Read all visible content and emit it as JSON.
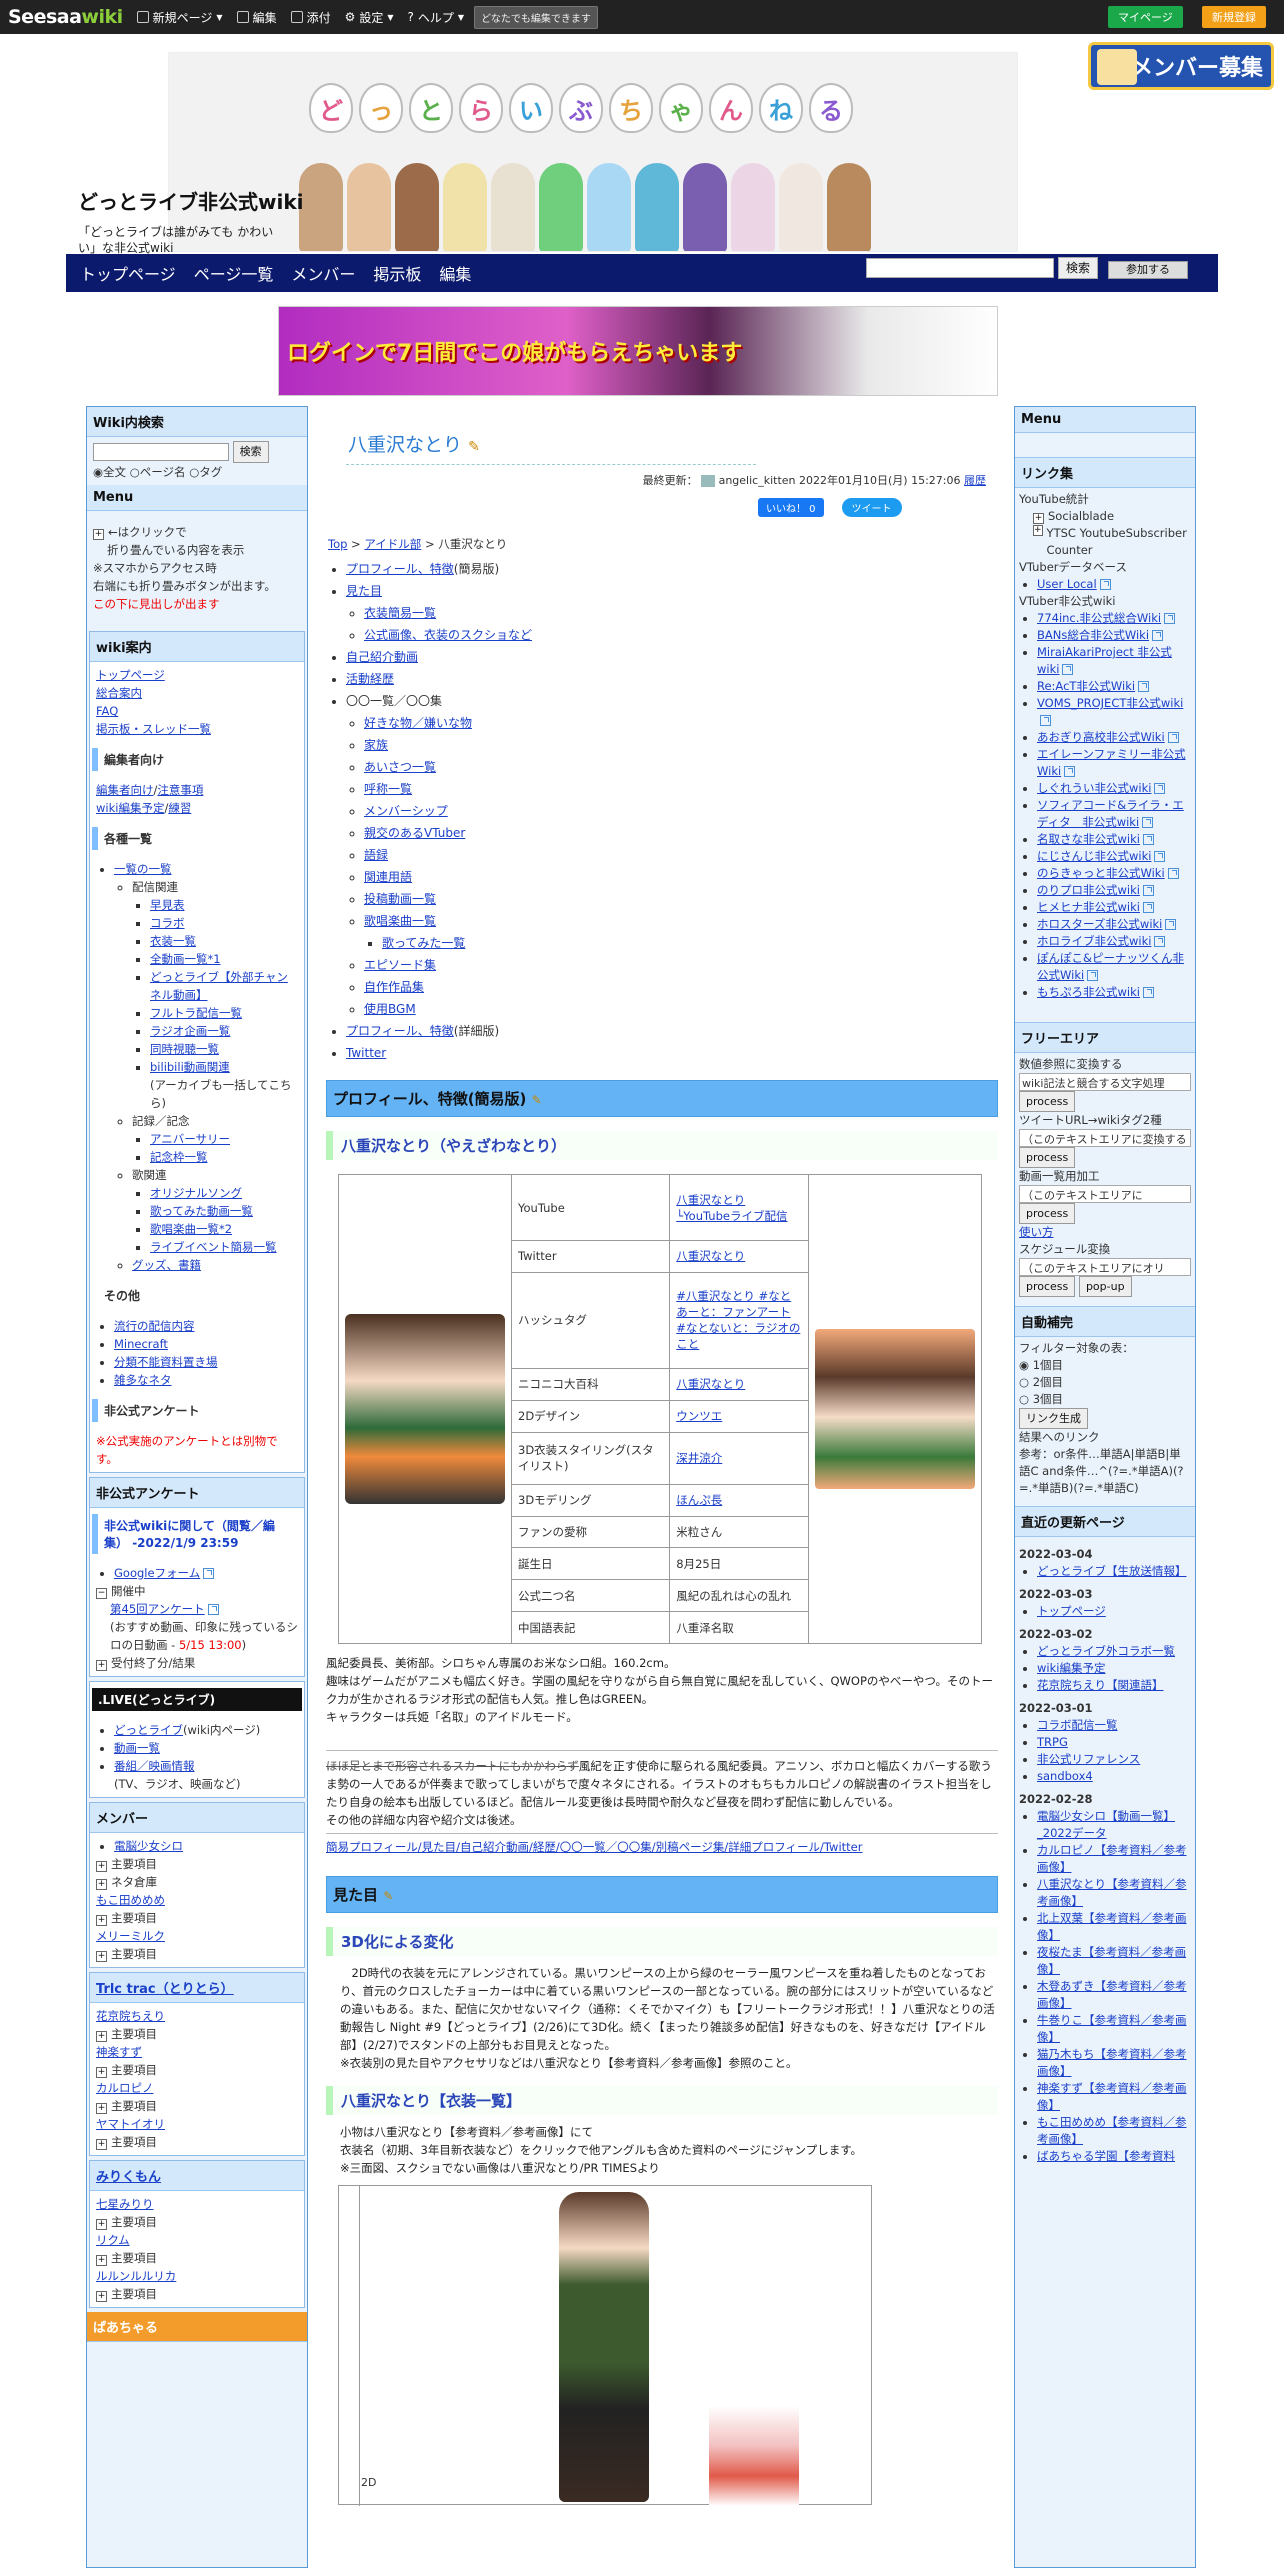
{
  "topbar": {
    "logo_a": "Seesaa",
    "logo_b": "wiki",
    "menu": [
      "新規ページ",
      "編集",
      "添付",
      "設定",
      "ヘルプ"
    ],
    "anon_label": "どなたでも編集できます",
    "btn_mypage": "マイページ",
    "btn_register": "新規登録",
    "btn_mypage_color": "#1ba84a",
    "btn_register_color": "#f3a019"
  },
  "header": {
    "site_title": "どっとライブ非公式wiki",
    "site_desc": "「どっとライブは誰がみても かわいい」な非公式wiki",
    "logo_chars": [
      "ど",
      "っ",
      "と",
      "ら",
      "い",
      "ぶ",
      "ち",
      "ゃ",
      "ん",
      "ね",
      "る"
    ],
    "member_box": "メンバー募集"
  },
  "nav": {
    "items": [
      "トップページ",
      "ページ一覧",
      "メンバー",
      "掲示板",
      "編集"
    ],
    "search_btn": "検索",
    "join_btn": "参加する"
  },
  "banner": {
    "text": "ログインで7日間でこの娘がもらえちゃいます"
  },
  "left": {
    "search_title": "Wiki内検索",
    "search_btn": "検索",
    "radios": [
      "全文",
      "ページ名",
      "タグ"
    ],
    "menu_title": "Menu",
    "menu_note": [
      "←はクリックで",
      "折り畳んでいる内容を表示",
      "※スマホからアクセス時",
      "右端にも折り畳みボタンが出ます。",
      "この下に見出しが出ます"
    ],
    "guide_title": "wiki案内",
    "guide_links": [
      "トップページ",
      "総合案内",
      "FAQ",
      "掲示板・スレッド一覧"
    ],
    "editor_title": "編集者向け",
    "editor_links": [
      "編集者向け",
      "注意事項",
      "wiki編集予定",
      "練習"
    ],
    "lists_title": "各種一覧",
    "lists_root": "一覧の一覧",
    "lists_group1": "配信関連",
    "lists_items1": [
      "早見表",
      "コラボ",
      "衣装一覧",
      "全動画一覧*1",
      "どっとライブ【外部チャンネル動画】",
      "フルトラ配信一覧",
      "ラジオ企画一覧",
      "同時視聴一覧",
      "bilibili動画関連"
    ],
    "lists_bili_note": "(アーカイブも一括してこちら)",
    "lists_group2": "記録／記念",
    "lists_items2": [
      "アニバーサリー",
      "記念枠一覧"
    ],
    "lists_group3": "歌関連",
    "lists_items3": [
      "オリジナルソング",
      "歌ってみた動画一覧",
      "歌唱楽曲一覧*2",
      "ライブイベント簡易一覧"
    ],
    "lists_goods": "グッズ、書籍",
    "others_title": "その他",
    "others_links": [
      "流行の配信内容",
      "Minecraft",
      "分類不能資料置き場",
      "雑多なネタ"
    ],
    "survey_title": "非公式アンケート",
    "survey_note": "※公式実施のアンケートとは別物です。",
    "survey2_title": "非公式アンケート",
    "survey2_q": "非公式wikiに関して（閲覧／編集）",
    "survey2_date": "-2022/1/9 23:59",
    "survey2_form": "Googleフォーム",
    "survey2_open": "開催中",
    "survey2_item": "第45回アンケート",
    "survey2_desc": "(おすすめ動画、印象に残っているシロの日動画 - ",
    "survey2_deadline": "5/15 13:00",
    "survey2_close": "受付終了分/結果",
    "live_title": ".LIVE(どっとライブ)",
    "live_links": [
      "どっとライブ",
      "動画一覧",
      "番組／映画情報"
    ],
    "live_sub": "(wiki内ページ)",
    "live_note": "(TV、ラジオ、映画など)",
    "member_title": "メンバー",
    "member_items": [
      "電脳少女シロ",
      "主要項目",
      "ネタ倉庫",
      "もこ田めめめ",
      "主要項目",
      "メリーミルク",
      "主要項目"
    ],
    "trlc_title": "Trlc trac（とりとら）",
    "trlc_items": [
      "花京院ちえり",
      "主要項目",
      "神楽すず",
      "主要項目",
      "カルロピノ",
      "主要項目",
      "ヤマトイオリ",
      "主要項目"
    ],
    "mirikumu_title": "みりくもん",
    "mirikumu_items": [
      "七星みりり",
      "主要項目",
      "リクム",
      "主要項目",
      "ルルンルルリカ",
      "主要項目"
    ],
    "bottom_title": "ぱあちゃる"
  },
  "main": {
    "title": "八重沢なとり",
    "lastup_label": "最終更新：",
    "lastup_user": "angelic_kitten",
    "lastup_date": "2022年01月10日(月) 15:27:06",
    "history": "履歴",
    "fb": "いいね！ 0",
    "tw": "ツイート",
    "crumb": [
      "Top",
      "アイドル部",
      "八重沢なとり"
    ],
    "toc": [
      {
        "t": "プロフィール、特徴",
        "s": "(簡易版)"
      },
      {
        "t": "見た目",
        "c": [
          "衣装簡易一覧",
          "公式画像、衣装のスクショなど"
        ]
      },
      {
        "t": "自己紹介動画"
      },
      {
        "t": "活動経歴"
      },
      {
        "t": "〇〇一覧／〇〇集",
        "c": [
          "好きな物／嫌いな物",
          "家族",
          "あいさつ一覧",
          "呼称一覧",
          "メンバーシップ",
          "親交のあるVTuber",
          "語録",
          "関連用語",
          "投稿動画一覧",
          "歌唱楽曲一覧",
          "歌ってみた一覧",
          "エピソード集",
          "自作作品集",
          "使用BGM"
        ]
      },
      {
        "t": "プロフィール、特徴",
        "s": "(詳細版)"
      },
      {
        "t": "Twitter"
      }
    ],
    "h_profile": "プロフィール、特徴(簡易版)",
    "h_name": "八重沢なとり（やえざわなとり）",
    "profile": [
      [
        "YouTube",
        "八重沢なとり └YouTubeライブ配信"
      ],
      [
        "Twitter",
        "八重沢なとり"
      ],
      [
        "ハッシュタグ",
        "#八重沢なとり #なとあーと：ファンアート #なとないと：ラジオのこと"
      ],
      [
        "ニコニコ大百科",
        "八重沢なとり"
      ],
      [
        "2Dデザイン",
        "ウンツエ"
      ],
      [
        "3D衣装スタイリング(スタイリスト)",
        "深井涼介"
      ],
      [
        "3Dモデリング",
        "ほんぷ長"
      ],
      [
        "ファンの愛称",
        "米粒さん"
      ],
      [
        "誕生日",
        "8月25日"
      ],
      [
        "公式二つ名",
        "風紀の乱れは心の乱れ"
      ],
      [
        "中国語表記",
        "八重泽名取"
      ]
    ],
    "intro1": "風紀委員長、美術部。シロちゃん専属のお米なシロ組。160.2cm。",
    "intro2": "趣味はゲームだがアニメも幅広く好き。学園の風紀を守りながら自ら無自覚に風紀を乱していく、QWOPのやべーやつ。そのトーク力が生かされるラジオ形式の配信も人気。推し色はGREEN。",
    "intro3": "キャラクターは兵姫「名取」のアイドルモード。",
    "detail_strike": "ほほ足とまで形容されるスカートにもかかわらず",
    "detail_rest": "風紀を正す使命に駆られる風紀委員。アニソン、ボカロと幅広くカバーする歌うま勢の一人であるが伴奏まで歌ってしまいがちで度々ネタにされる。イラストのオもちもカルロピノの解説書のイラスト担当をしたり自身の絵本も出版しているほど。配信ルール変更後は長時間や耐久など昼夜を問わず配信に勤しんでいる。",
    "detail_more": "その他の詳細な内容や紹介文は後述。",
    "quicklinks": "簡易プロフィール/見た目/自己紹介動画/経歴/〇〇一覧／〇〇集/別稿ページ集/詳細プロフィール/Twitter",
    "h_look": "見た目",
    "h_3d": "3D化による変化",
    "look_p": "2D時代の衣装を元にアレンジされている。黒いワンピースの上から緑のセーラー風ワンピースを重ね着したものとなっており、首元のクロスしたチョーカーは中に着ている黒いワンピースの一部となっている。腕の部分にはスリットが空いているなどの違いもある。また、配信に欠かせないマイク（通称：くそでかマイク）も【フリートークラジオ形式！！】八重沢なとりの活動報告し Night #9【どっとライブ】(2/26)にて3D化。続く【まったり雑談多め配信】好きなものを、好きなだけ【アイドル部】(2/27)でスタンドの上部分もお目見えとなった。",
    "look_note": "※衣装別の見た目やアクセサリなどは八重沢なとり【参考資料／参考画像】参照のこと。",
    "h_costume": "八重沢なとり【衣装一覧】",
    "cos1": "小物は八重沢なとり【参考資料／参考画像】にて",
    "cos2": "衣装名（初期、3年目新衣装など）をクリックで他アングルも含めた資料のページにジャンプします。",
    "cos3": "※三面図、スクショでない画像は八重沢なとり/PR TIMESより",
    "cos_cell": "2D"
  },
  "right": {
    "menu_title": "Menu",
    "links_title": "リンク集",
    "yt_stats": "YouTube統計",
    "yt_items": [
      "Socialblade",
      "YTSC YoutubeSubscriber Counter"
    ],
    "vdb": "VTuberデータベース",
    "vdb_items": [
      "User Local"
    ],
    "vwiki": "VTuber非公式wiki",
    "vwiki_items": [
      "774inc.非公式総合Wiki",
      "BANs総合非公式Wiki",
      "MiraiAkariProject 非公式wiki",
      "Re:AcT非公式Wiki",
      "VOMS_PROJECT非公式wiki",
      "あおぎり高校非公式Wiki",
      "エイレーンファミリー非公式Wiki",
      "しぐれうい非公式wiki",
      "ソフィアコード&ライラ・エディタ　非公式wiki",
      "名取さな非公式wiki",
      "にじさんじ非公式wiki",
      "のらきゃっと非公式Wiki",
      "のりプロ非公式wiki",
      "ヒメヒナ非公式wiki",
      "ホロスターズ非公式wiki",
      "ホロライブ非公式wiki",
      "ぽんぽこ&ピーナッツくん非公式Wiki",
      "もちぷろ非公式wiki"
    ],
    "free_title": "フリーエリア",
    "free_items": [
      {
        "label": "数値参照に変換する",
        "ta": "wiki記法と競合する文字処理",
        "btn": "process"
      },
      {
        "label": "ツイートURL→wikiタグ2種",
        "ta": "（このテキストエリアに変換する",
        "btn": "process"
      },
      {
        "label": "動画一覧用加工",
        "ta": "（このテキストエリアに",
        "btn": "process"
      },
      {
        "label": "使い方",
        "ta": "",
        "btn": ""
      },
      {
        "label": "スケジュール変換",
        "ta": "（このテキストエリアにオリ",
        "btn": "process",
        "btn2": "pop-up"
      }
    ],
    "auto_title": "自動補完",
    "auto_label": "フィルター対象の表：",
    "auto_radios": [
      "1個目",
      "2個目",
      "3個目"
    ],
    "auto_btn": "リンク生成",
    "auto_result": "結果へのリンク",
    "auto_ref": "参考：or条件…単語A|単語B|単語C and条件…^(?=.*単語A)(?=.*単語B)(?=.*単語C)",
    "recent_title": "直近の更新ページ",
    "recent": [
      {
        "d": "2022-03-04",
        "i": [
          "どっとライブ【生放送情報】"
        ]
      },
      {
        "d": "2022-03-03",
        "i": [
          "トップページ"
        ]
      },
      {
        "d": "2022-03-02",
        "i": [
          "どっとライブ外コラボ一覧",
          "wiki編集予定",
          "花京院ちえり【関連語】"
        ]
      },
      {
        "d": "2022-03-01",
        "i": [
          "コラボ配信一覧",
          "TRPG",
          "非公式リファレンス",
          "sandbox4"
        ]
      },
      {
        "d": "2022-02-28",
        "i": [
          "電脳少女シロ【動画一覧】_2022データ",
          "カルロピノ【参考資料／参考画像】",
          "八重沢なとり【参考資料／参考画像】",
          "北上双葉【参考資料／参考画像】",
          "夜桜たま【参考資料／参考画像】",
          "木登あずき【参考資料／参考画像】",
          "牛巻りこ【参考資料／参考画像】",
          "猫乃木もち【参考資料／参考画像】",
          "神楽すず【参考資料／参考画像】",
          "もこ田めめめ【参考資料／参考画像】",
          "ばあちゃる学園【参考資料"
        ]
      }
    ]
  }
}
